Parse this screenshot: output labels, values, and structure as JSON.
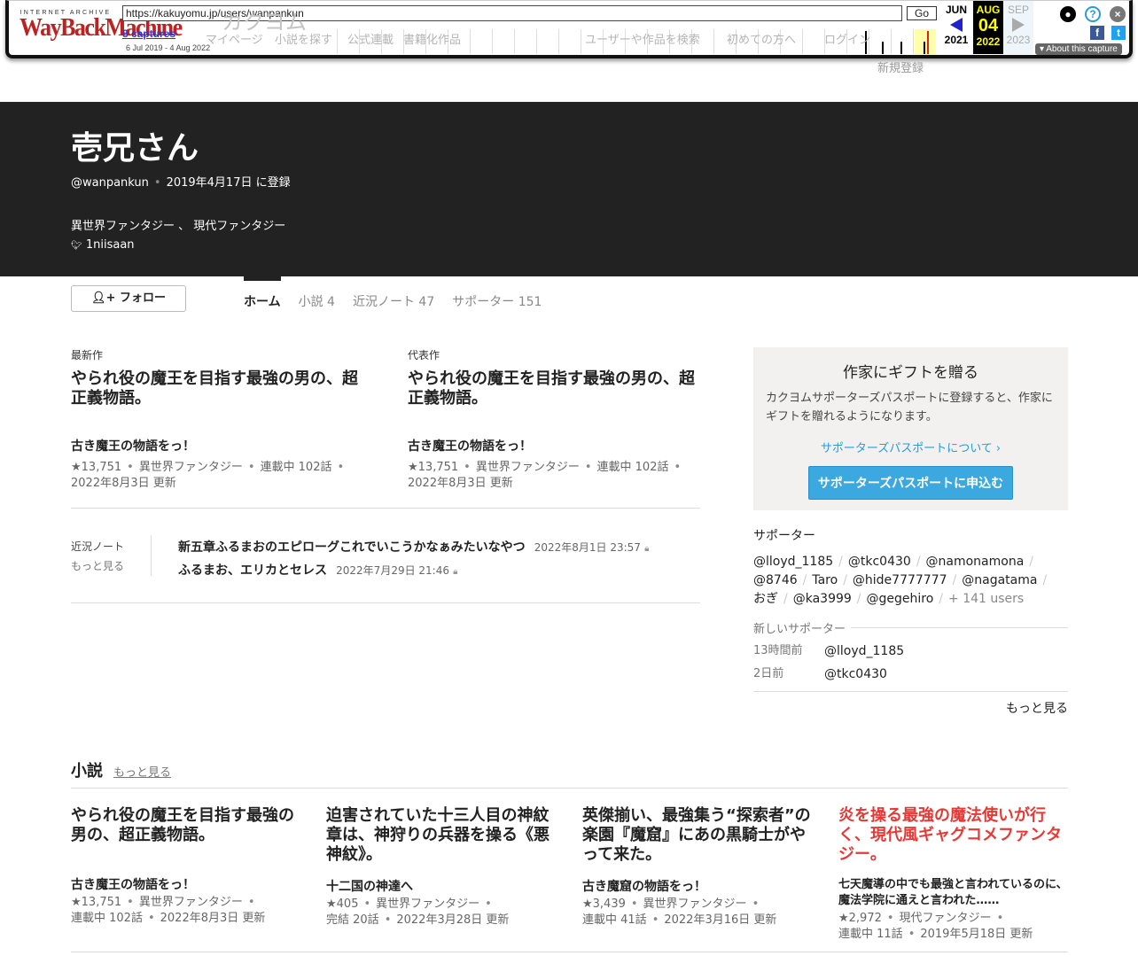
{
  "site_nav": {
    "logo": "カクヨム",
    "items": [
      "マイページ",
      "小説を探す",
      "公式連載",
      "書籍化作品"
    ],
    "search_placeholder": "ユーザーや作品を検索",
    "first": "初めての方へ",
    "login": "ログイン",
    "signup": "新規登録"
  },
  "wayback": {
    "ia": "INTERNET ARCHIVE",
    "logo": "WayBackMachine",
    "url": "https://kakuyomu.jp/users/wanpankun",
    "go": "Go",
    "captures": "8 captures",
    "range": "6 Jul 2019 - 4 Aug 2022",
    "prev": {
      "month": "JUN",
      "year": "2021"
    },
    "current": {
      "month": "AUG",
      "day": "04",
      "year": "2022"
    },
    "next": {
      "month": "SEP",
      "year": "2023"
    },
    "about": "About this capture",
    "colors": {
      "highlight": "#ffff00",
      "logo": "#b22222"
    }
  },
  "profile": {
    "name": "壱兄さん",
    "handle": "@wanpankun",
    "registered": "2019年4月17日 に登録",
    "genres": "異世界ファンタジー 、 現代ファンタジー",
    "twitter": "1niisaan"
  },
  "follow_label": "フォロー",
  "tabs": [
    {
      "label": "ホーム",
      "count": ""
    },
    {
      "label": "小説",
      "count": "4"
    },
    {
      "label": "近況ノート",
      "count": "47"
    },
    {
      "label": "サポーター",
      "count": "151"
    }
  ],
  "latest": {
    "label": "最新作",
    "title": "やられ役の魔王を目指す最強の男の、超正義物語。",
    "catch": "古き魔王の物語をっ！",
    "stars": "★13,751",
    "genre": "異世界ファンタジー",
    "status": "連載中 102話",
    "updated": "2022年8月3日 更新"
  },
  "featured": {
    "label": "代表作",
    "title": "やられ役の魔王を目指す最強の男の、超正義物語。",
    "catch": "古き魔王の物語をっ！",
    "stars": "★13,751",
    "genre": "異世界ファンタジー",
    "status": "連載中 102話",
    "updated": "2022年8月3日 更新"
  },
  "notes": {
    "label": "近況ノート",
    "more": "もっと見る",
    "items": [
      {
        "title": "新五章ふるまおのエピローグこれでいこうかなぁみたいなやつ",
        "date": "2022年8月1日 23:57"
      },
      {
        "title": "ふるまお、エリカとセレス",
        "date": "2022年7月29日 21:46"
      }
    ]
  },
  "gift": {
    "title": "作家にギフトを贈る",
    "text": "カクヨムサポーターズパスポートに登録すると、作家にギフトを贈れるようになります。",
    "link": "サポーターズパスポートについて ›",
    "button": "サポーターズパスポートに申込む"
  },
  "supporters": {
    "title": "サポーター",
    "users": [
      "@lloyd_1185",
      "@tkc0430",
      "@namonamona",
      "@8746",
      "Taro",
      "@hide7777777",
      "@nagatama",
      "おぎ",
      "@ka3999",
      "@gegehiro"
    ],
    "more_users": "+ 141 users",
    "new_label": "新しいサポーター",
    "new": [
      {
        "time": "13時間前",
        "user": "@lloyd_1185"
      },
      {
        "time": "2日前",
        "user": "@tkc0430"
      }
    ],
    "more": "もっと見る"
  },
  "novels": {
    "title": "小説",
    "more": "もっと見る",
    "items": [
      {
        "title": "やられ役の魔王を目指す最強の男の、超正義物語。",
        "catch": "古き魔王の物語をっ！",
        "stars": "★13,751",
        "genre": "異世界ファンタジー",
        "status": "連載中 102話",
        "updated": "2022年8月3日 更新"
      },
      {
        "title": "迫害されていた十三人目の神紋章は、神狩りの兵器を操る《悪神紋》。",
        "catch": "十二国の神達へ",
        "stars": "★405",
        "genre": "異世界ファンタジー",
        "status": "完結 20話",
        "updated": "2022年3月28日 更新"
      },
      {
        "title": "英傑揃い、最強集う“探索者”の楽園『魔窟』にあの黒騎士がやって来た。",
        "catch": "古き魔窟の物語をっ！",
        "stars": "★3,439",
        "genre": "異世界ファンタジー",
        "status": "連載中 41話",
        "updated": "2022年3月16日 更新"
      },
      {
        "title": "炎を操る最強の魔法使いが行く、現代風ギャグコメファンタジー。",
        "catch": "七天魔導の中でも最強と言われているのに、魔法学院に通えと言われた……",
        "stars": "★2,972",
        "genre": "現代ファンタジー",
        "status": "連載中 11話",
        "updated": "2019年5月18日 更新"
      }
    ]
  }
}
